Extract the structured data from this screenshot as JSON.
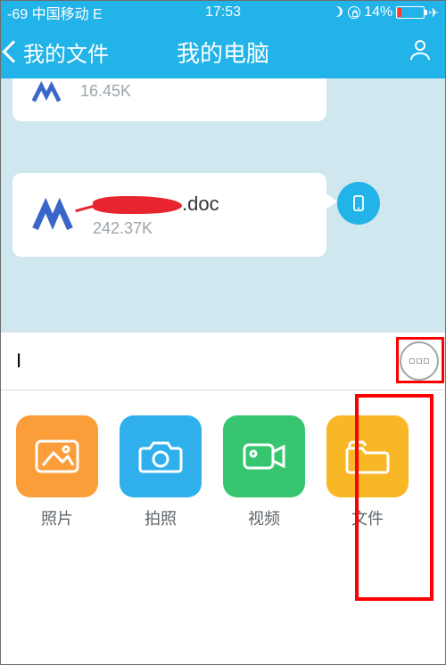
{
  "statusbar": {
    "carrier": "-69 中国移动  E",
    "time": "17:53",
    "battery": "14%"
  },
  "nav": {
    "back_label": "我的文件",
    "title": "我的电脑"
  },
  "messages": {
    "partial": {
      "size": "16.45K"
    },
    "full": {
      "name_suffix": ".doc",
      "size": "242.37K"
    }
  },
  "input": {
    "value": "I"
  },
  "panel": {
    "items": [
      {
        "label": "照片"
      },
      {
        "label": "拍照"
      },
      {
        "label": "视频"
      },
      {
        "label": "文件"
      }
    ]
  }
}
